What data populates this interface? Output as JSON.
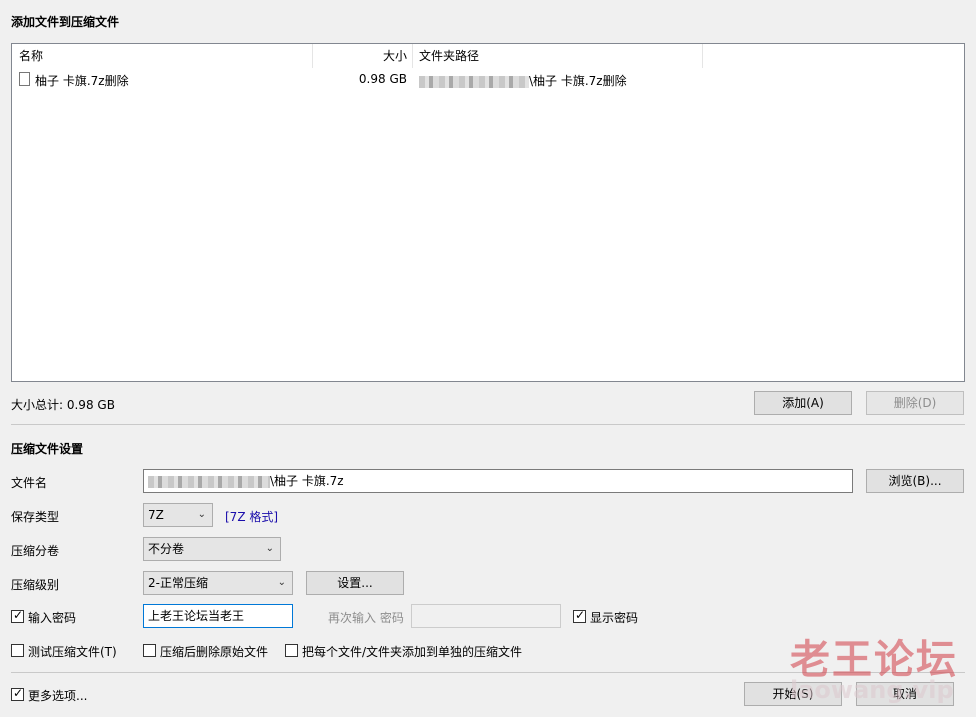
{
  "window": {
    "title": "添加文件到压缩文件"
  },
  "file_list": {
    "columns": [
      "名称",
      "大小",
      "文件夹路径"
    ],
    "rows": [
      {
        "name": "柚子 卡旗.7z删除",
        "size": "0.98 GB",
        "path_suffix": "\\柚子 卡旗.7z删除"
      }
    ]
  },
  "summary": {
    "total_label": "大小总计: 0.98 GB"
  },
  "buttons": {
    "add": "添加(A)",
    "delete": "删除(D)",
    "browse": "浏览(B)...",
    "settings": "设置...",
    "start": "开始(S)",
    "cancel": "取消"
  },
  "settings": {
    "section_title": "压缩文件设置",
    "filename_label": "文件名",
    "filename_suffix": "\\柚子 卡旗.7z",
    "type_label": "保存类型",
    "type_value": "7Z",
    "type_format_link": "[7Z 格式]",
    "split_label": "压缩分卷",
    "split_value": "不分卷",
    "level_label": "压缩级别",
    "level_value": "2-正常压缩",
    "password_label": "输入密码",
    "password_value": "上老王论坛当老王",
    "password_repeat_label": "再次输入 密码",
    "show_password_label": "显示密码",
    "test_label": "测试压缩文件(T)",
    "delete_after_label": "压缩后删除原始文件",
    "each_file_label": "把每个文件/文件夹添加到单独的压缩文件",
    "more_options_label": "更多选项..."
  },
  "checkboxes": {
    "password": true,
    "show_password": true,
    "test": false,
    "delete_after": false,
    "each_file": false,
    "more_options": true
  },
  "watermark": {
    "text": "老王论坛",
    "url": "laowang.vip"
  }
}
